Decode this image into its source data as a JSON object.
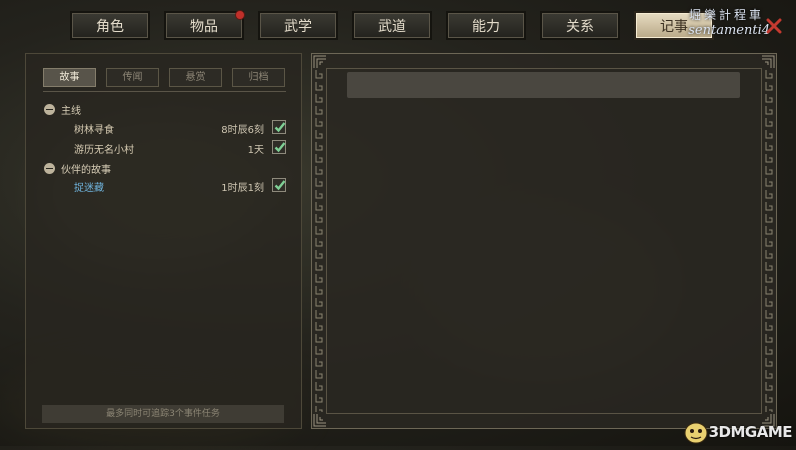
{
  "top_tabs": [
    {
      "label": "角色",
      "active": false
    },
    {
      "label": "物品",
      "active": false,
      "badge": true
    },
    {
      "label": "武学",
      "active": false
    },
    {
      "label": "武道",
      "active": false
    },
    {
      "label": "能力",
      "active": false
    },
    {
      "label": "关系",
      "active": false
    },
    {
      "label": "记事",
      "active": true
    }
  ],
  "watermark": {
    "cn": "堀樂計程車",
    "en": "sentamenti4"
  },
  "sub_tabs": [
    "故事",
    "传闻",
    "悬赏",
    "归档"
  ],
  "active_sub_tab": "故事",
  "categories": [
    {
      "label": "主线",
      "quests": [
        {
          "name": "树林寻食",
          "time": "8时辰6刻",
          "done": true,
          "highlight": false
        },
        {
          "name": "游历无名小村",
          "time": "1天",
          "done": true,
          "highlight": false
        }
      ]
    },
    {
      "label": "伙伴的故事",
      "quests": [
        {
          "name": "捉迷藏",
          "time": "1时辰1刻",
          "done": true,
          "highlight": true
        }
      ]
    }
  ],
  "bottom_note": "最多同时可追踪3个事件任务",
  "logo": {
    "text": "3DMGAME"
  },
  "colors": {
    "active_tab": "#d8cbad",
    "check": "#7fcf95",
    "highlight_quest": "#6fb3dc"
  }
}
